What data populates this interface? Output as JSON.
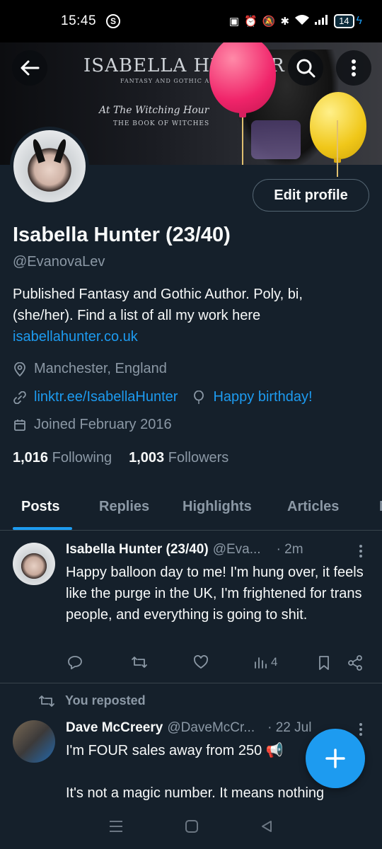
{
  "status_bar": {
    "time": "15:45",
    "battery": "14"
  },
  "banner": {
    "title": "ISABELLA HUNTER",
    "subtitle": "FANTASY AND GOTHIC AUTHOR",
    "script_line": "At The Witching Hour",
    "book_line": "THE BOOK OF WITCHES"
  },
  "profile": {
    "name": "Isabella Hunter (23/40)",
    "handle": "@EvanovaLev",
    "bio": "Published Fantasy and Gothic Author. Poly, bi, (she/her). Find a list of all my work here",
    "bio_link": "isabellahunter.co.uk",
    "location": "Manchester, England",
    "website": "linktr.ee/IsabellaHunter",
    "birthday": "Happy birthday!",
    "joined": "Joined February 2016",
    "following_count": "1,016",
    "following_label": "Following",
    "followers_count": "1,003",
    "followers_label": "Followers",
    "edit_label": "Edit profile"
  },
  "tabs": [
    {
      "label": "Posts"
    },
    {
      "label": "Replies"
    },
    {
      "label": "Highlights"
    },
    {
      "label": "Articles"
    }
  ],
  "posts": [
    {
      "name": "Isabella Hunter (23/40)",
      "handle": "@Eva...",
      "time": "· 2m",
      "text": "Happy balloon day to me! I'm hung over, it feels like the purge in the UK, I'm frightened for trans people, and everything is going to shit.",
      "views": "4"
    },
    {
      "repost_label": "You reposted",
      "name": "Dave McCreery",
      "handle": "@DaveMcCr...",
      "time": "· 22 Jul",
      "text_line1": "I'm FOUR sales away from 250 📢",
      "text_line2": "It's not a magic number. It means nothing"
    }
  ],
  "colors": {
    "background": "#15202b",
    "accent": "#1d9bf0",
    "muted": "#8b98a5"
  }
}
